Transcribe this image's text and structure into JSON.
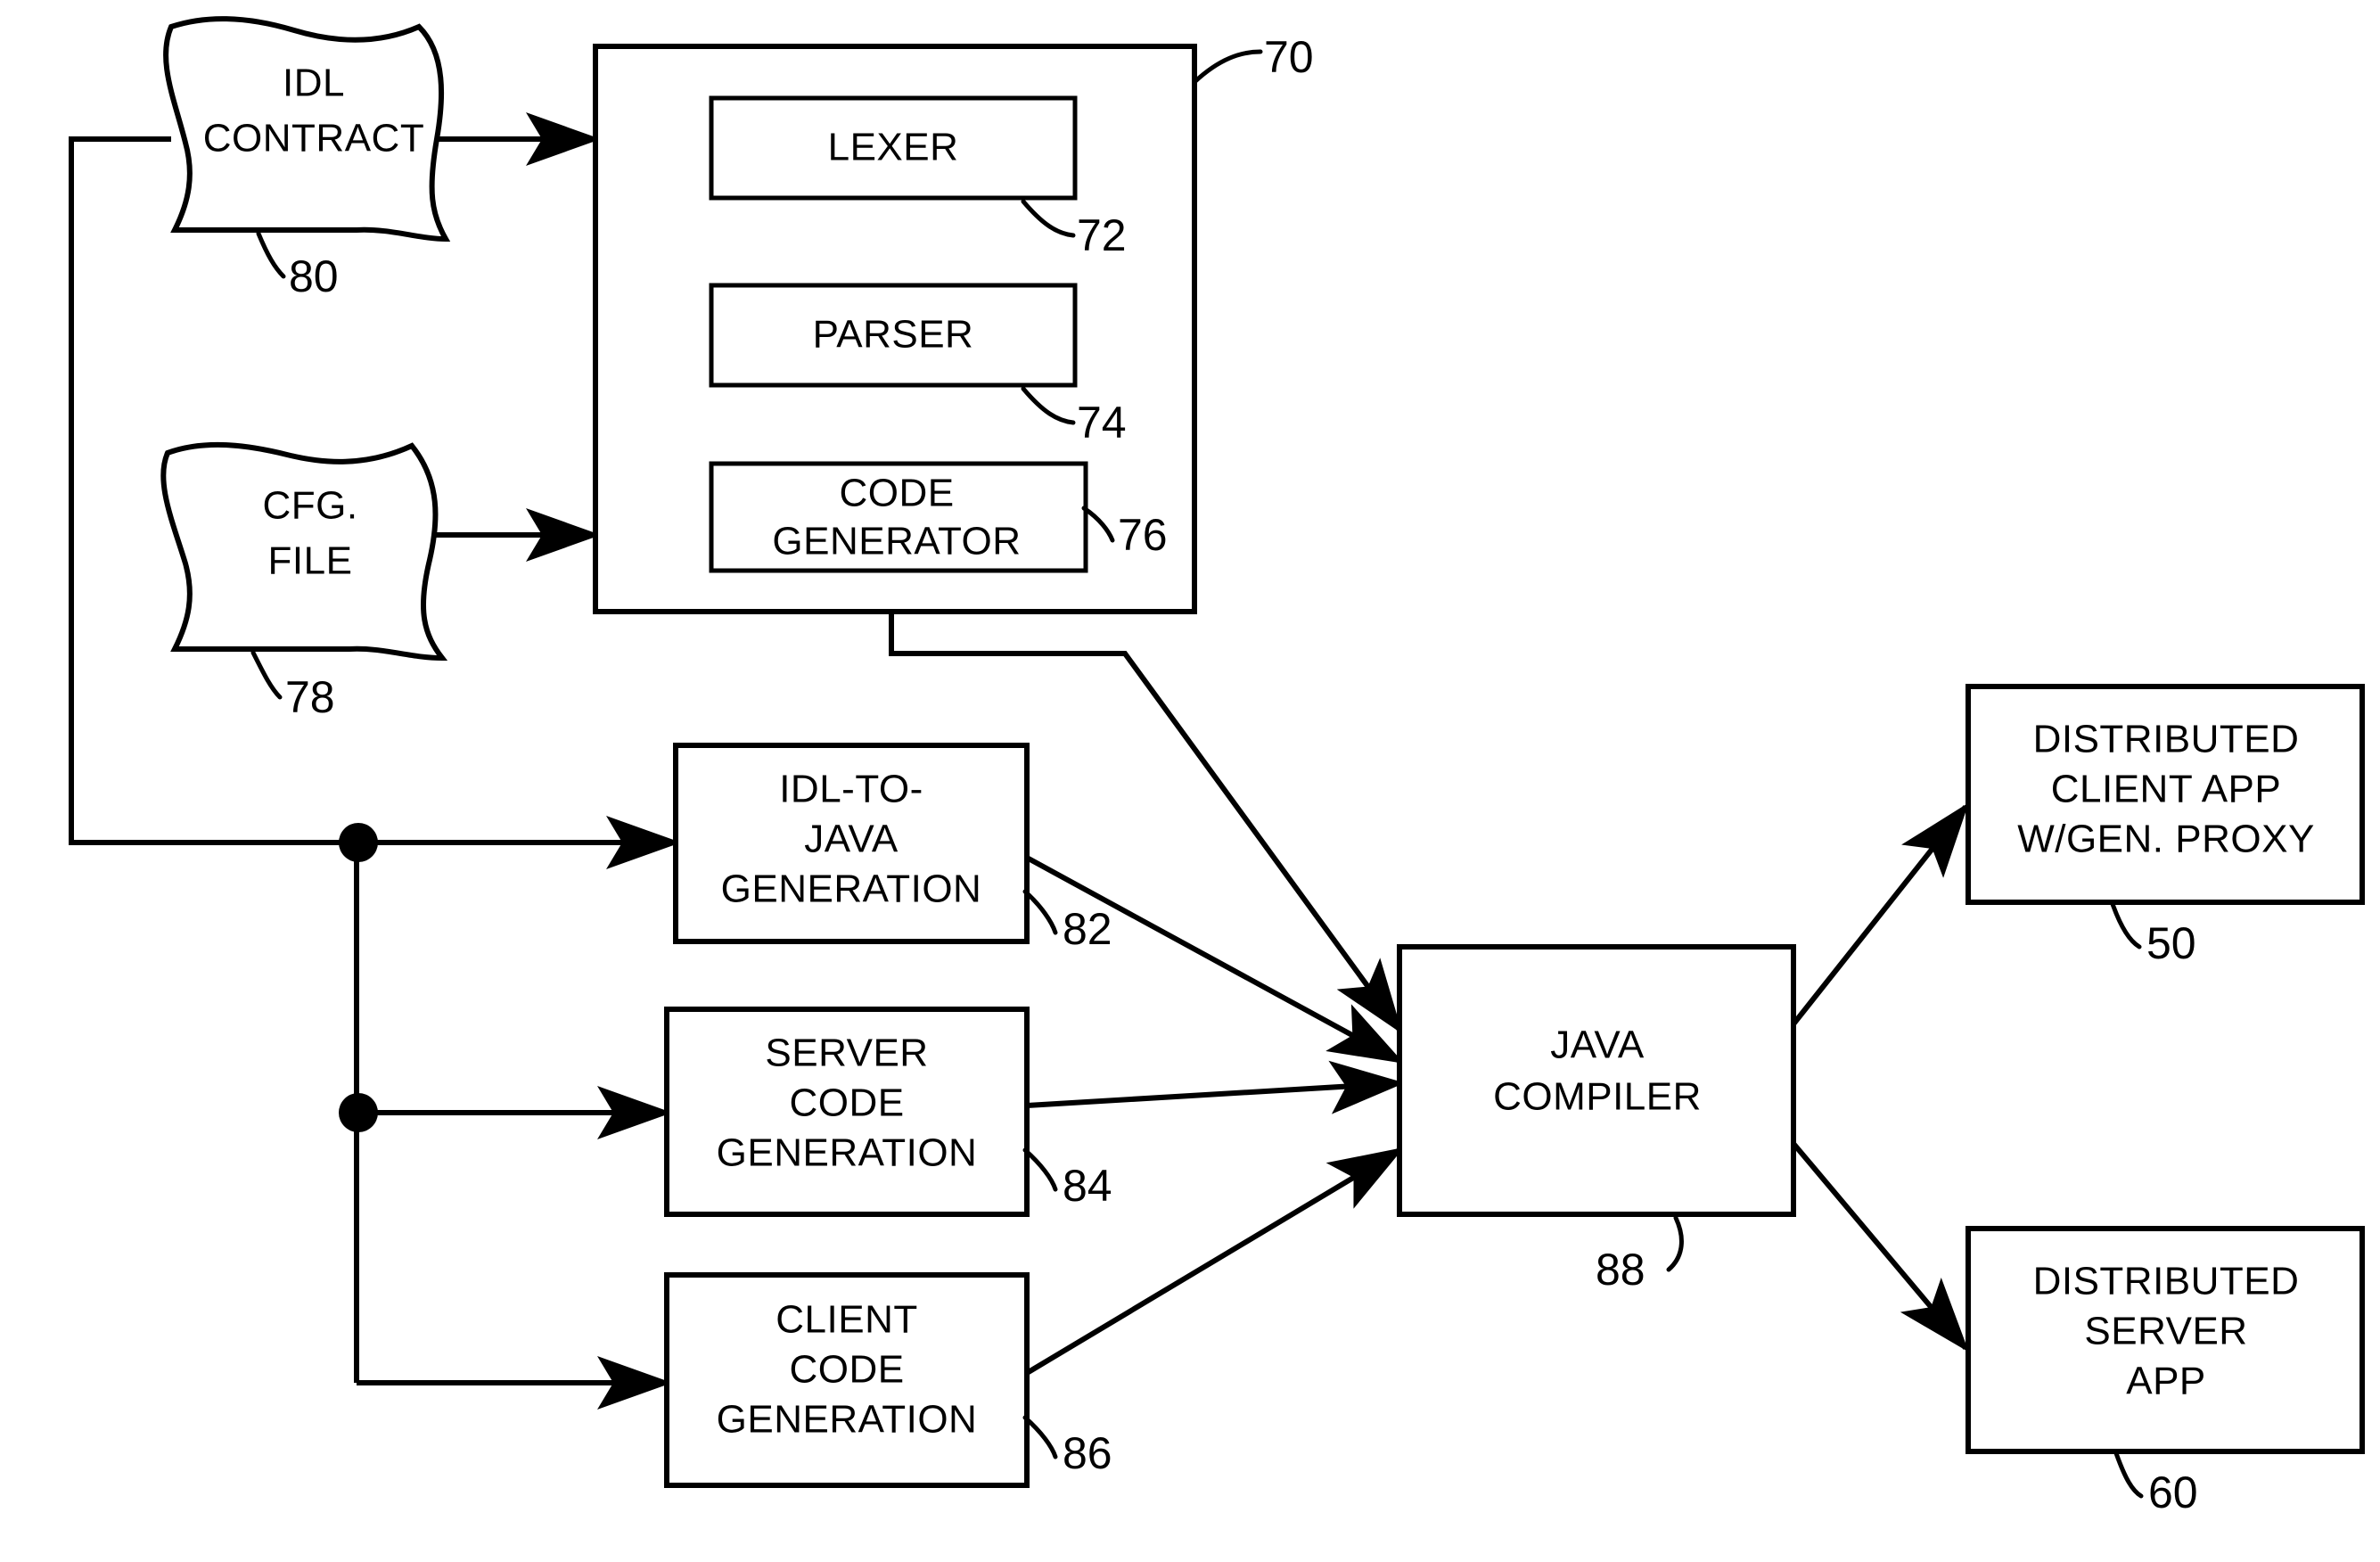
{
  "figure": {
    "title": "IDL compiler code generation flow diagram",
    "stroke_color": "#000000",
    "background_color": "#ffffff"
  },
  "nodes": {
    "idl_contract": {
      "label_line1": "IDL",
      "label_line2": "CONTRACT",
      "ref": "80",
      "shape": "document"
    },
    "cfg_file": {
      "label_line1": "CFG.",
      "label_line2": "FILE",
      "ref": "78",
      "shape": "document"
    },
    "compiler_container": {
      "ref": "70",
      "shape": "rect"
    },
    "lexer": {
      "label_line1": "LEXER",
      "ref": "72",
      "shape": "rect"
    },
    "parser": {
      "label_line1": "PARSER",
      "ref": "74",
      "shape": "rect"
    },
    "code_generator": {
      "label_line1": "CODE",
      "label_line2": "GENERATOR",
      "ref": "76",
      "shape": "rect"
    },
    "idl_to_java_generation": {
      "label_line1": "IDL-TO-",
      "label_line2": "JAVA",
      "label_line3": "GENERATION",
      "ref": "82",
      "shape": "rect"
    },
    "server_code_generation": {
      "label_line1": "SERVER",
      "label_line2": "CODE",
      "label_line3": "GENERATION",
      "ref": "84",
      "shape": "rect"
    },
    "client_code_generation": {
      "label_line1": "CLIENT",
      "label_line2": "CODE",
      "label_line3": "GENERATION",
      "ref": "86",
      "shape": "rect"
    },
    "java_compiler": {
      "label_line1": "JAVA",
      "label_line2": "COMPILER",
      "ref": "88",
      "shape": "rect"
    },
    "distributed_client_app": {
      "label_line1": "DISTRIBUTED",
      "label_line2": "CLIENT APP",
      "label_line3": "W/GEN. PROXY",
      "ref": "50",
      "shape": "rect"
    },
    "distributed_server_app": {
      "label_line1": "DISTRIBUTED",
      "label_line2": "SERVER",
      "label_line3": "APP",
      "ref": "60",
      "shape": "rect"
    }
  },
  "edges": [
    {
      "from": "idl_contract",
      "to": "compiler_container",
      "arrow": true
    },
    {
      "from": "cfg_file",
      "to": "compiler_container",
      "arrow": true
    },
    {
      "from": "lexer",
      "to": "parser",
      "arrow": false
    },
    {
      "from": "parser",
      "to": "code_generator",
      "arrow": false
    },
    {
      "from": "code_generator",
      "to": "java_compiler",
      "arrow": true
    },
    {
      "from": "idl_contract",
      "to": "idl_to_java_generation",
      "arrow": true
    },
    {
      "from": "idl_contract",
      "to": "server_code_generation",
      "arrow": true
    },
    {
      "from": "idl_contract",
      "to": "client_code_generation",
      "arrow": true
    },
    {
      "from": "idl_to_java_generation",
      "to": "java_compiler",
      "arrow": true
    },
    {
      "from": "server_code_generation",
      "to": "java_compiler",
      "arrow": true
    },
    {
      "from": "client_code_generation",
      "to": "java_compiler",
      "arrow": true
    },
    {
      "from": "java_compiler",
      "to": "distributed_client_app",
      "arrow": true
    },
    {
      "from": "java_compiler",
      "to": "distributed_server_app",
      "arrow": true
    }
  ],
  "reference_numerals": [
    "50",
    "60",
    "70",
    "72",
    "74",
    "76",
    "78",
    "80",
    "82",
    "84",
    "86",
    "88"
  ]
}
